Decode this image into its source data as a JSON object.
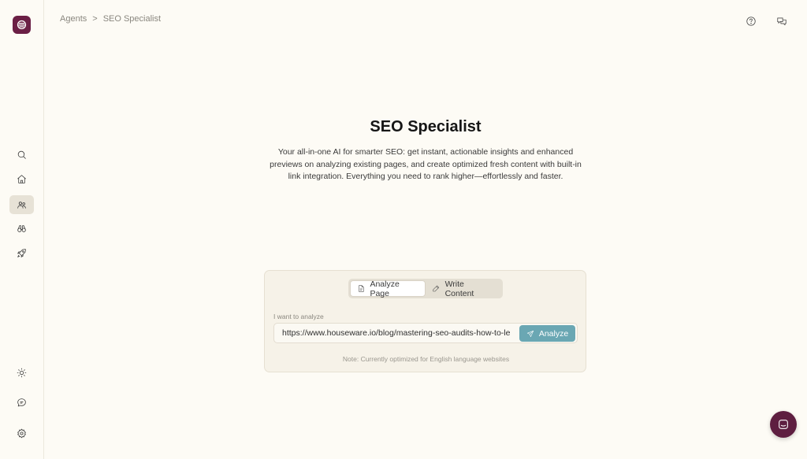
{
  "breadcrumb": {
    "parent": "Agents",
    "separator": ">",
    "current": "SEO Specialist"
  },
  "hero": {
    "title": "SEO Specialist",
    "description": "Your all-in-one AI for smarter SEO: get instant, actionable insights and enhanced previews on analyzing existing pages, and create optimized fresh content with built-in link integration. Everything you need to rank higher—effortlessly and faster."
  },
  "card": {
    "tabs": [
      {
        "label": "Analyze Page",
        "icon": "document-icon",
        "active": true
      },
      {
        "label": "Write Content",
        "icon": "pen-icon",
        "active": false
      }
    ],
    "field_label": "I want to analyze",
    "url_value": "https://www.houseware.io/blog/mastering-seo-audits-how-to-le",
    "analyze_label": "Analyze",
    "note": "Note: Currently optimized for English language websites"
  },
  "sidebar": {
    "items": [
      "search-icon",
      "home-icon",
      "agents-icon",
      "binoculars-icon",
      "rocket-icon"
    ],
    "bottom_items": [
      "sun-icon",
      "chat-icon",
      "settings-icon"
    ]
  },
  "top_icons": [
    "help-icon",
    "conversations-icon"
  ],
  "colors": {
    "brand": "#6b1f45",
    "accent": "#6aa7b3",
    "background": "#fdfbf5"
  }
}
